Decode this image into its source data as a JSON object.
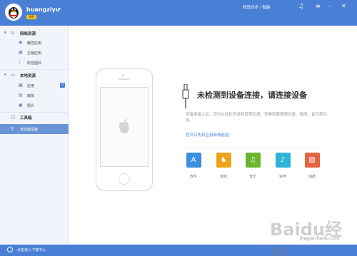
{
  "header": {
    "username": "huangziyu",
    "vip_badge": "VIP",
    "pc_link": "修改同步 / 智能"
  },
  "sidebar": {
    "network_section": "网络资源",
    "network_items": [
      "触控应用",
      "正版应用",
      "影音图铃"
    ],
    "local_section": "本地资源",
    "local_items": [
      "应用",
      "媒体",
      "照片"
    ],
    "local_app_count": "0",
    "toolbox": "工具箱",
    "device": "未连接设备"
  },
  "main": {
    "headline": "未检测到设备连接，请连接设备",
    "description": "设备连接之后，您可以轻松安装和管理应用，查看和整理通讯录、相册、音乐和铃声。",
    "store_hint": "也可以先到应用商场逛逛：",
    "categories": [
      {
        "label": "软件",
        "color": "#3d8fe0",
        "icon": "app-store-icon"
      },
      {
        "label": "游戏",
        "color": "#f0a21c",
        "icon": "chess-knight-icon"
      },
      {
        "label": "音乐",
        "color": "#6ab52e",
        "icon": "music-disc-icon"
      },
      {
        "label": "铃声",
        "color": "#2fb4d8",
        "icon": "bell-icon"
      },
      {
        "label": "墙纸",
        "color": "#e3643f",
        "icon": "picture-icon"
      }
    ]
  },
  "footer": {
    "label": "点击进入下载中心",
    "watermark_logo": "Baidu经验",
    "watermark_url": "jingyan.baidu.com"
  },
  "colors": {
    "brand": "#4a7fd6",
    "sidebar_bg": "#f1f5fb",
    "active_item": "#6b94d7"
  }
}
